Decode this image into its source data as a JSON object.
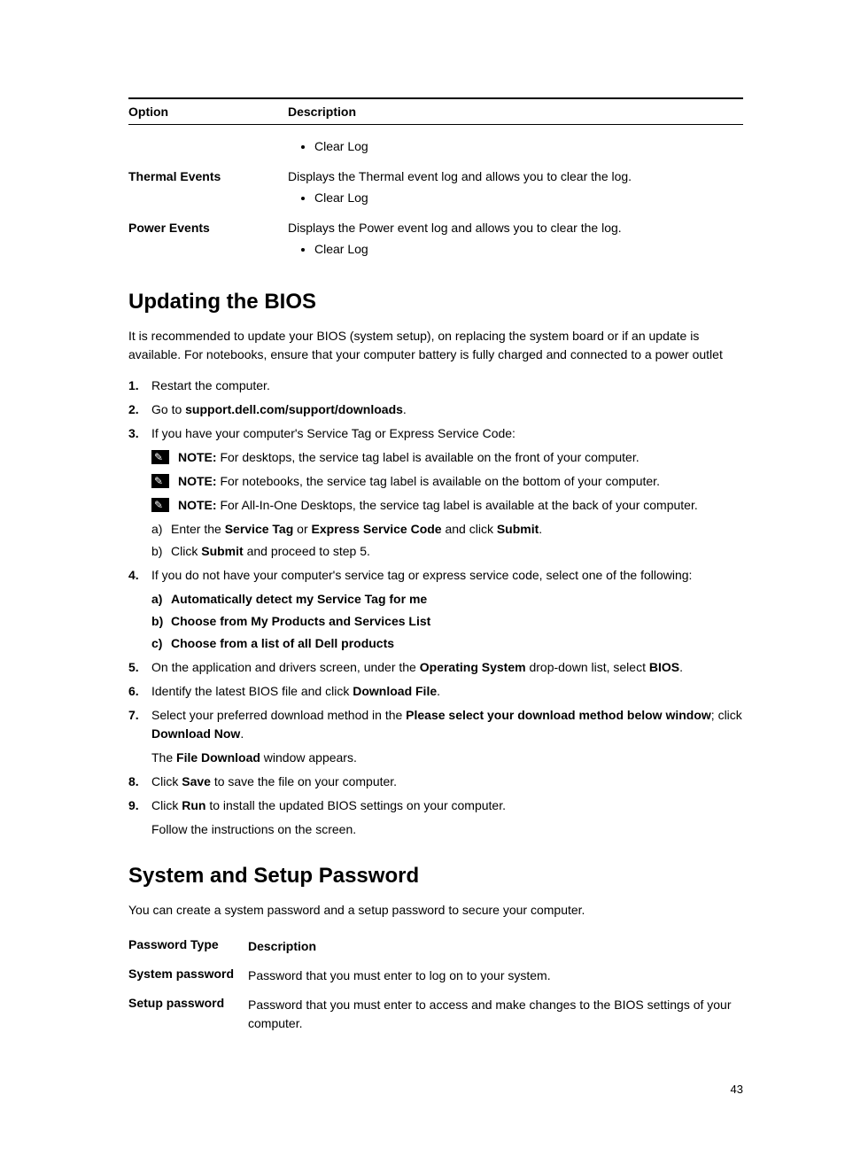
{
  "events_table": {
    "header_option": "Option",
    "header_description": "Description",
    "row0_bullet": "Clear Log",
    "row1_option": "Thermal Events",
    "row1_desc": "Displays the Thermal event log and allows you to clear the log.",
    "row1_bullet": "Clear Log",
    "row2_option": "Power Events",
    "row2_desc": "Displays the Power event log and allows you to clear the log.",
    "row2_bullet": "Clear Log"
  },
  "section_bios": {
    "heading": "Updating the BIOS",
    "intro": "It is recommended to update your BIOS (system setup), on replacing the system board or if an update is available. For notebooks, ensure that your computer battery is fully charged and connected to a power outlet",
    "step1": "Restart the computer.",
    "step2_a": "Go to ",
    "step2_b": "support.dell.com/support/downloads",
    "step2_c": ".",
    "step3": "If you have your computer's Service Tag or Express Service Code:",
    "note1_label": "NOTE: ",
    "note1_text": "For desktops, the service tag label is available on the front of your computer.",
    "note2_label": "NOTE: ",
    "note2_text": "For notebooks, the service tag label is available on the bottom of your computer.",
    "note3_label": "NOTE: ",
    "note3_text": "For All-In-One Desktops, the service tag label is available at the back of your computer.",
    "step3a_1": "Enter the ",
    "step3a_2": "Service Tag",
    "step3a_3": " or ",
    "step3a_4": "Express Service Code",
    "step3a_5": " and click ",
    "step3a_6": "Submit",
    "step3a_7": ".",
    "step3b_1": "Click ",
    "step3b_2": "Submit",
    "step3b_3": " and proceed to step 5.",
    "step4": "If you do not have your computer's service tag or express service code, select one of the following:",
    "step4a": "Automatically detect my Service Tag for me",
    "step4b": "Choose from My Products and Services List",
    "step4c": "Choose from a list of all Dell products",
    "step5_1": "On the application and drivers screen, under the ",
    "step5_2": "Operating System",
    "step5_3": " drop-down list, select ",
    "step5_4": "BIOS",
    "step5_5": ".",
    "step6_1": "Identify the latest BIOS file and click ",
    "step6_2": "Download File",
    "step6_3": ".",
    "step7_1": "Select your preferred download method in the ",
    "step7_2": "Please select your download method below window",
    "step7_3": "; click ",
    "step7_4": "Download Now",
    "step7_5": ".",
    "step7_follow_1": "The ",
    "step7_follow_2": "File Download",
    "step7_follow_3": " window appears.",
    "step8_1": "Click ",
    "step8_2": "Save",
    "step8_3": " to save the file on your computer.",
    "step9_1": "Click ",
    "step9_2": "Run",
    "step9_3": " to install the updated BIOS settings on your computer.",
    "step9_follow": "Follow the instructions on the screen."
  },
  "section_pwd": {
    "heading": "System and Setup Password",
    "intro": "You can create a system password and a setup password to secure your computer.",
    "header_type": "Password Type",
    "header_desc": "Description",
    "row1_type": "System password",
    "row1_desc": "Password that you must enter to log on to your system.",
    "row2_type": "Setup password",
    "row2_desc": "Password that you must enter to access and make changes to the BIOS settings of your computer."
  },
  "page_number": "43"
}
